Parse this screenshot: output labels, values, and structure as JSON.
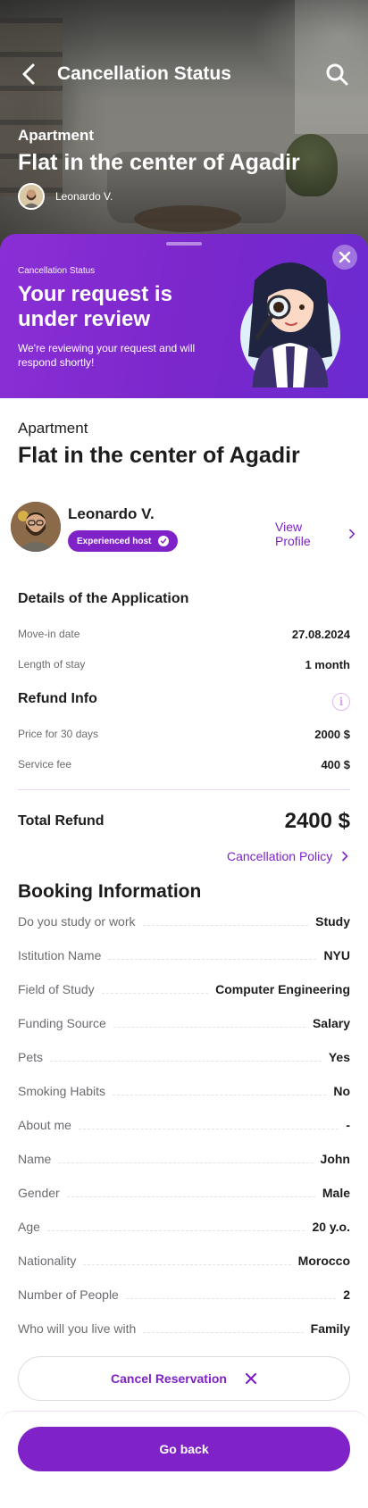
{
  "header": {
    "title": "Cancellation Status",
    "back_icon": "chevron-left-icon",
    "search_icon": "search-icon"
  },
  "hero": {
    "type": "Apartment",
    "title": "Flat in the center of Agadir",
    "host_name": "Leonardo V."
  },
  "status": {
    "label": "Cancellation Status",
    "heading": "Your request is under review",
    "description": "We're reviewing your request and will respond shortly!",
    "close_icon": "close-icon"
  },
  "listing": {
    "type": "Apartment",
    "title": "Flat in the center of Agadir"
  },
  "host": {
    "name": "Leonardo V.",
    "badge": "Experienced host",
    "view_profile": "View Profile"
  },
  "application": {
    "heading": "Details of the Application",
    "rows": [
      {
        "label": "Move-in date",
        "value": "27.08.2024"
      },
      {
        "label": "Length of stay",
        "value": "1 month"
      }
    ]
  },
  "refund": {
    "heading": "Refund Info",
    "info_icon": "info-icon",
    "rows": [
      {
        "label": "Price for 30 days",
        "value": "2000 $"
      },
      {
        "label": "Service fee",
        "value": "400 $"
      }
    ],
    "total_label": "Total Refund",
    "total_value": "2400 $",
    "policy_link": "Cancellation Policy"
  },
  "booking": {
    "heading": "Booking Information",
    "rows": [
      {
        "label": "Do you study or work",
        "value": "Study"
      },
      {
        "label": "Istitution Name",
        "value": "NYU"
      },
      {
        "label": "Field of Study",
        "value": "Computer Engineering"
      },
      {
        "label": "Funding Source",
        "value": "Salary"
      },
      {
        "label": "Pets",
        "value": "Yes"
      },
      {
        "label": "Smoking Habits",
        "value": "No"
      },
      {
        "label": "About me",
        "value": "-"
      },
      {
        "label": "Name",
        "value": "John"
      },
      {
        "label": "Gender",
        "value": "Male"
      },
      {
        "label": "Age",
        "value": "20 y.o."
      },
      {
        "label": "Nationality",
        "value": "Morocco"
      },
      {
        "label": "Number of People",
        "value": "2"
      },
      {
        "label": "Who will you live with",
        "value": "Family"
      }
    ]
  },
  "actions": {
    "cancel_label": "Cancel Reservation",
    "go_back_label": "Go back"
  },
  "colors": {
    "accent": "#7f22c8",
    "status_gradient_start": "#8a2fd6",
    "status_gradient_end": "#6b2bd0"
  }
}
